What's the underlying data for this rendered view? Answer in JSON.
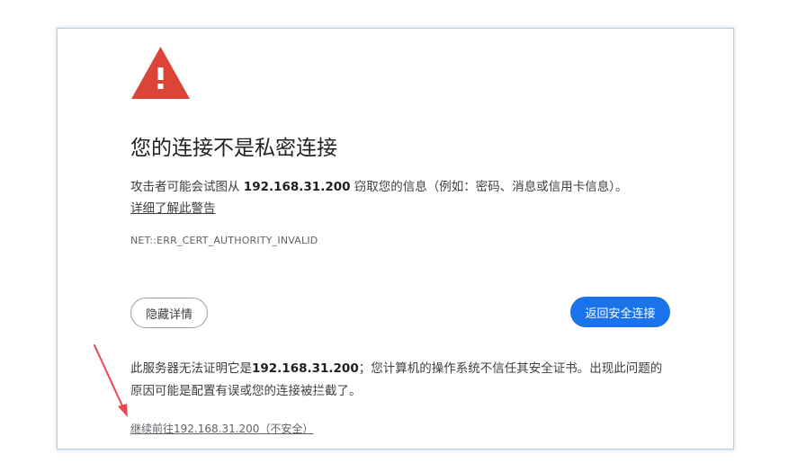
{
  "page": {
    "title": "您的连接不是私密连接",
    "description_prefix": "攻击者可能会试图从 ",
    "host": "192.168.31.200",
    "description_suffix": " 窃取您的信息（例如：密码、消息或信用卡信息）。",
    "learn_more": "详细了解此警告",
    "error_code": "NET::ERR_CERT_AUTHORITY_INVALID"
  },
  "buttons": {
    "details_label": "隐藏详情",
    "back_label": "返回安全连接"
  },
  "details": {
    "text_prefix": "此服务器无法证明它是",
    "host": "192.168.31.200",
    "text_suffix": "；您计算机的操作系统不信任其安全证书。出现此问题的原因可能是配置有误或您的连接被拦截了。",
    "proceed_link": "继续前往192.168.31.200（不安全）"
  },
  "colors": {
    "warning": "#db4437",
    "primary_button": "#1a73e8",
    "annotation_arrow": "#e8474e"
  }
}
